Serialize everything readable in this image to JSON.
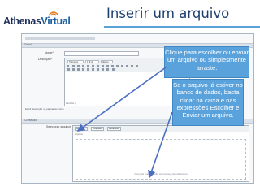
{
  "logo": {
    "part1": "Athenas",
    "part2": "Virtual"
  },
  "slide_title": "Inserir um arquivo",
  "form": {
    "section_general": "Geral",
    "name_label": "Nome",
    "description_label": "Descrição",
    "font_select": "Trebuchet",
    "size_select": "1 (8 pt)",
    "language_select": "Idioma",
    "editor_path": "Caminho: p",
    "show_description": "Exibir descrição na página do curso",
    "section_content": "Conteúdo",
    "files_label": "Selecionar arquivos",
    "fm_btn_add": "Adicionar...",
    "fm_btn_folder": "Criar pasta",
    "fm_btn_download": "Baixar tudo",
    "fm_path": "Arquivos",
    "drop_hint": "Você pode arrastar e soltar arquivos aqui para adicioná-los"
  },
  "callouts": {
    "upload": "Clique para escolher ou enviar um arquivo ou simplesmente arraste.",
    "database": "Se o arquivo já estiver no banco de dados, basta clicar na caixa e nas expressões Escolher e Enviar um arquivo."
  },
  "colors": {
    "accent": "#5aa2dc",
    "title": "#1c3f6e",
    "arrow": "#4a6fc1"
  }
}
